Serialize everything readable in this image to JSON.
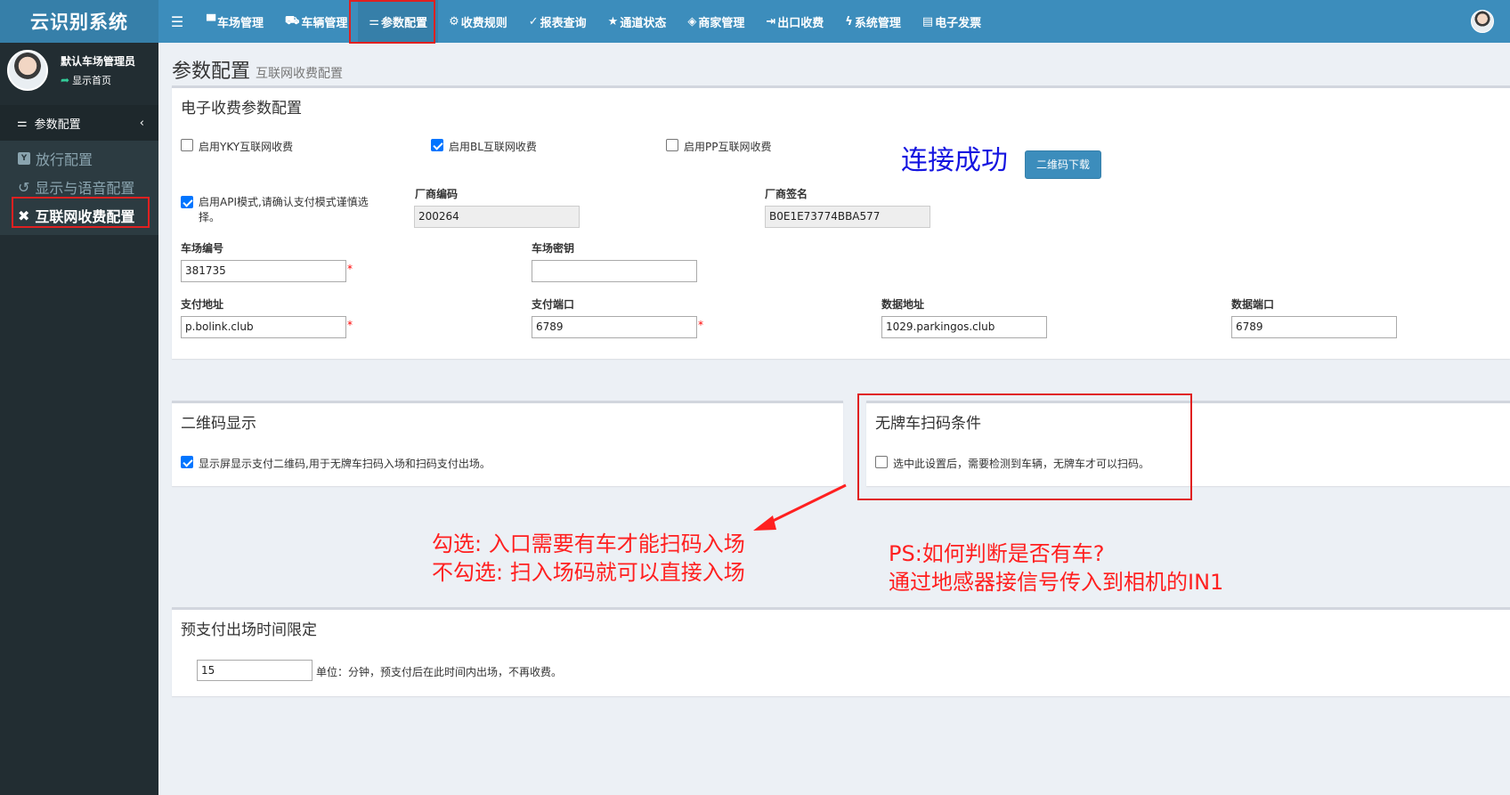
{
  "app": {
    "title": "云识别系统"
  },
  "user": {
    "name": "默认车场管理员",
    "link": "显示首页"
  },
  "sidebar": {
    "section": {
      "icon": "sliders-icon",
      "label": "参数配置",
      "chevron": "‹"
    },
    "items": [
      {
        "label": "放行配置",
        "icon": "y-square-icon"
      },
      {
        "label": "显示与语音配置",
        "icon": "history-icon"
      },
      {
        "label": "互联网收费配置",
        "icon": "x-square-icon",
        "active": true
      }
    ]
  },
  "topnav": {
    "menu_icon": "☰",
    "items": [
      {
        "icon": "▀",
        "label": "车场管理"
      },
      {
        "icon": "⛟",
        "label": "车辆管理"
      },
      {
        "icon": "⚌",
        "label": "参数配置",
        "active": true
      },
      {
        "icon": "⚙",
        "label": "收费规则"
      },
      {
        "icon": "✓",
        "label": "报表查询"
      },
      {
        "icon": "★",
        "label": "通道状态"
      },
      {
        "icon": "◈",
        "label": "商家管理"
      },
      {
        "icon": "⇥",
        "label": "出口收费"
      },
      {
        "icon": "ϟ",
        "label": "系统管理"
      },
      {
        "icon": "▤",
        "label": "电子发票"
      }
    ]
  },
  "page": {
    "title": "参数配置",
    "subtitle": "互联网收费配置"
  },
  "fee_config": {
    "title": "电子收费参数配置",
    "yky": {
      "label": "启用YKY互联网收费",
      "checked": false
    },
    "bl": {
      "label": "启用BL互联网收费",
      "checked": true
    },
    "pp": {
      "label": "启用PP互联网收费",
      "checked": false
    },
    "connection_status": "连接成功",
    "qr_download_button": "二维码下载",
    "api_mode": {
      "label_line1": "启用API模式,请确认支付模式谨慎选",
      "label_line2": "择。",
      "checked": true
    },
    "vendor_code": {
      "label": "厂商编码",
      "value": "200264"
    },
    "vendor_sign": {
      "label": "厂商签名",
      "value": "B0E1E73774BBA577"
    },
    "lot_no": {
      "label": "车场编号",
      "value": "381735"
    },
    "lot_key": {
      "label": "车场密钥",
      "value": ""
    },
    "pay_addr": {
      "label": "支付地址",
      "value": "p.bolink.club"
    },
    "pay_port": {
      "label": "支付端口",
      "value": "6789"
    },
    "data_addr": {
      "label": "数据地址",
      "value": "1029.parkingos.club"
    },
    "data_port": {
      "label": "数据端口",
      "value": "6789"
    },
    "required_mark": "*"
  },
  "qr_display": {
    "title": "二维码显示",
    "option": {
      "label": "显示屏显示支付二维码,用于无牌车扫码入场和扫码支付出场。",
      "checked": true
    }
  },
  "no_plate": {
    "title": "无牌车扫码条件",
    "option": {
      "label": "选中此设置后，需要检测到车辆，无牌车才可以扫码。",
      "checked": false
    }
  },
  "annotations": {
    "check_line1": "勾选:     入口需要有车才能扫码入场",
    "check_line2": "不勾选:  扫入场码就可以直接入场",
    "ps_line1": "PS:如何判断是否有车?",
    "ps_line2": "通过地感器接信号传入到相机的IN1"
  },
  "prepay": {
    "title": "预支付出场时间限定",
    "value": "15",
    "unit_text": "单位：分钟，预支付后在此时间内出场，不再收费。"
  },
  "colors": {
    "nav_bg": "#3c8dbc",
    "sidebar_bg": "#222d32",
    "annotation_red": "#ff2020",
    "connection_blue": "#1515e0"
  }
}
